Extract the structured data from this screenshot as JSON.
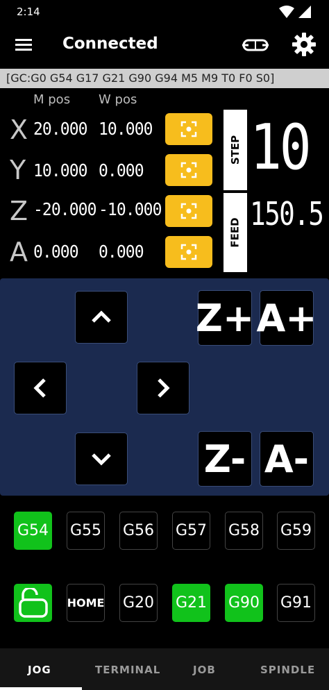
{
  "status_bar": {
    "time": "2:14"
  },
  "app_bar": {
    "title": "Connected"
  },
  "gcode_state": "[GC:G0 G54 G17 G21 G90 G94 M5 M9 T0 F0 S0]",
  "dro": {
    "mpos_header": "M pos",
    "wpos_header": "W pos",
    "axes": [
      {
        "letter": "X",
        "mpos": "20.000",
        "wpos": "10.000"
      },
      {
        "letter": "Y",
        "mpos": "10.000",
        "wpos": "0.000"
      },
      {
        "letter": "Z",
        "mpos": "-20.000",
        "wpos": "-10.000"
      },
      {
        "letter": "A",
        "mpos": "0.000",
        "wpos": "0.000"
      }
    ],
    "step_label": "STEP",
    "step_value": "10",
    "feed_label": "FEED",
    "feed_value": "150.5"
  },
  "jog": {
    "z_plus": "Z+",
    "a_plus": "A+",
    "z_minus": "Z-",
    "a_minus": "A-"
  },
  "wcs": [
    "G54",
    "G55",
    "G56",
    "G57",
    "G58",
    "G59"
  ],
  "wcs_active": "G54",
  "controls": {
    "home": "HOME",
    "g20": "G20",
    "g21": "G21",
    "g90": "G90",
    "g91": "G91"
  },
  "tabs": [
    "JOG",
    "TERMINAL",
    "JOB",
    "SPINDLE"
  ],
  "active_tab": "JOG",
  "colors": {
    "accent_yellow": "#f7bd1d",
    "active_green": "#11c21b",
    "jog_panel": "#1b2a4f",
    "state_bar": "#cfcfcf"
  }
}
